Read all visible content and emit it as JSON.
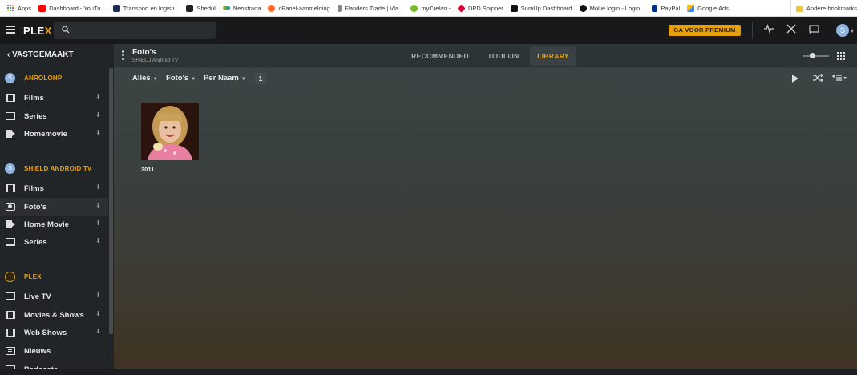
{
  "bookmarks": [
    {
      "label": "Apps",
      "icon": "apps-grid-icon",
      "color": "#4285f4"
    },
    {
      "label": "Dashboard - YouTu...",
      "icon": "youtube-icon",
      "color": "#ff0000"
    },
    {
      "label": "Transport en logisti...",
      "icon": "bookmark-favicon-icon",
      "color": "#1d2a55"
    },
    {
      "label": "Shedul",
      "icon": "bookmark-favicon-icon",
      "color": "#222222"
    },
    {
      "label": "Neostrada",
      "icon": "bookmark-favicon-icon",
      "color": "#e4a11b"
    },
    {
      "label": "cPanel-aanmelding",
      "icon": "cpanel-icon",
      "color": "#ff6c2c"
    },
    {
      "label": "Flanders Trade | Vla...",
      "icon": "bookmark-favicon-icon",
      "color": "#555555"
    },
    {
      "label": "myCrelan -",
      "icon": "bookmark-favicon-icon",
      "color": "#7ab929"
    },
    {
      "label": "DPD Shipper",
      "icon": "dpd-icon",
      "color": "#dc0032"
    },
    {
      "label": "SumUp Dashboard",
      "icon": "sumup-icon",
      "color": "#111111"
    },
    {
      "label": "Mollie login - Login...",
      "icon": "mollie-icon",
      "color": "#111111"
    },
    {
      "label": "PayPal",
      "icon": "paypal-icon",
      "color": "#003087"
    },
    {
      "label": "Google Ads",
      "icon": "google-ads-icon",
      "color": "#fbbc04"
    }
  ],
  "other_bookmarks": "Andere bookmarks",
  "topbar": {
    "logo_main": "PLE",
    "logo_x": "X",
    "premium_label": "GA VOOR PREMIUM",
    "avatar_letter": "S"
  },
  "sidebar": {
    "pinned_label": "VASTGEMAAKT",
    "sections": [
      {
        "name": "ANROLOHP",
        "avatar": "S",
        "items": [
          {
            "label": "Films",
            "icon": "film-icon"
          },
          {
            "label": "Series",
            "icon": "tv-icon"
          },
          {
            "label": "Homemovie",
            "icon": "video-camera-icon"
          }
        ]
      },
      {
        "name": "SHIELD ANDROID TV",
        "avatar": "S",
        "items": [
          {
            "label": "Films",
            "icon": "film-icon"
          },
          {
            "label": "Foto's",
            "icon": "camera-icon"
          },
          {
            "label": "Home Movie",
            "icon": "video-camera-icon"
          },
          {
            "label": "Series",
            "icon": "tv-icon"
          }
        ]
      },
      {
        "name": "PLEX",
        "avatar": "›",
        "items": [
          {
            "label": "Live TV",
            "icon": "tv-icon"
          },
          {
            "label": "Movies & Shows",
            "icon": "film-icon"
          },
          {
            "label": "Web Shows",
            "icon": "video-camera-icon"
          },
          {
            "label": "Nieuws",
            "icon": "news-icon"
          },
          {
            "label": "Podcasts",
            "icon": "podcast-icon"
          }
        ]
      }
    ]
  },
  "library": {
    "title": "Foto's",
    "subtitle": "SHIELD Android TV",
    "tabs": [
      "RECOMMENDED",
      "TIJDLIJN",
      "LIBRARY"
    ],
    "active_tab": "LIBRARY",
    "filters": [
      "Alles",
      "Foto's",
      "Per Naam"
    ],
    "count": "1",
    "items": [
      {
        "label": "2011"
      }
    ]
  },
  "colors": {
    "accent": "#e5a00d",
    "sidebar_bg": "#212528",
    "topbar_bg": "#17191b"
  }
}
